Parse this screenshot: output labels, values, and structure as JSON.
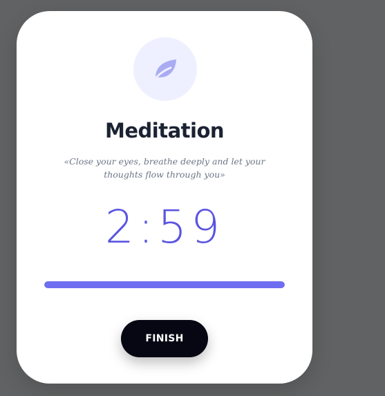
{
  "card": {
    "icon": "leaf-icon",
    "title": "Meditation",
    "quote": "«Close your eyes, breathe deeply and let your thoughts flow through you»",
    "timer": "2:59",
    "progress": 1.0,
    "finish_label": "FINISH"
  },
  "colors": {
    "accent": "#5b55e0",
    "progress": "#6f6df0",
    "icon_bg": "#eef0ff",
    "button_bg": "#070714",
    "background": "#616263"
  }
}
